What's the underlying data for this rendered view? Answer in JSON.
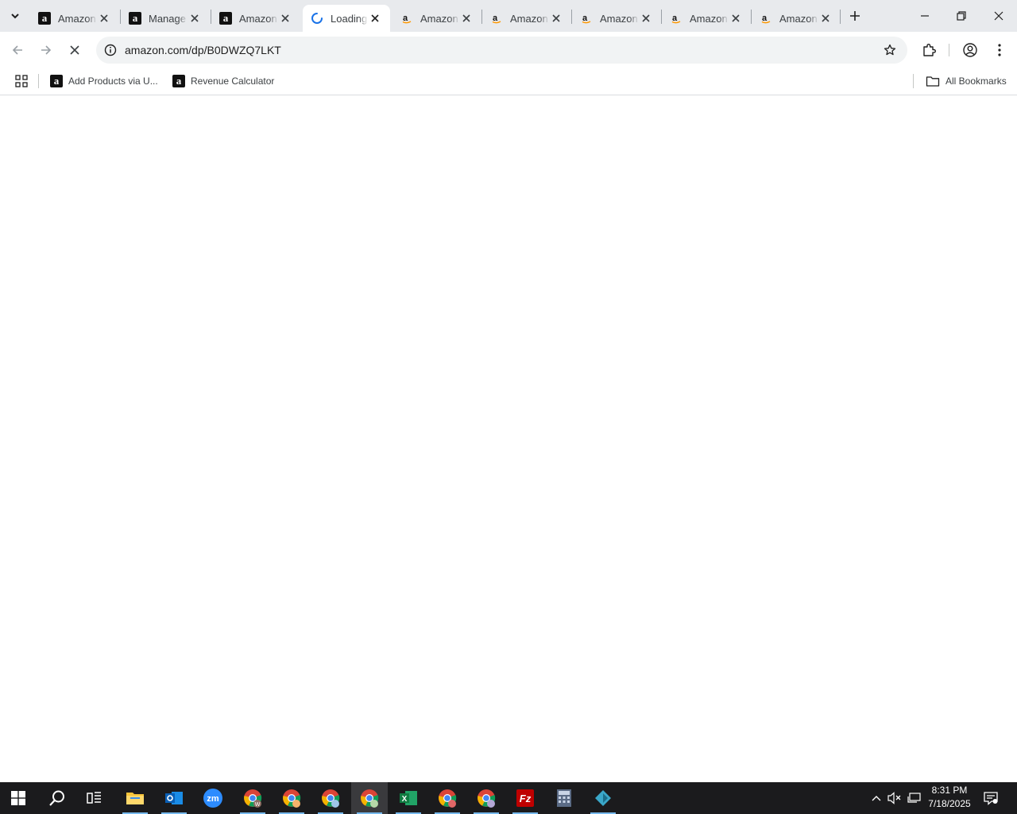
{
  "browser": {
    "tabs": [
      {
        "title": "Amazon",
        "favicon": "amazon-black-icon",
        "active": false
      },
      {
        "title": "Manage",
        "favicon": "amazon-black-icon",
        "active": false
      },
      {
        "title": "Amazon",
        "favicon": "amazon-black-icon",
        "active": false
      },
      {
        "title": "Loading",
        "favicon": "loading-spinner-icon",
        "active": true
      },
      {
        "title": "Amazon",
        "favicon": "amazon-smile-icon",
        "active": false
      },
      {
        "title": "Amazon",
        "favicon": "amazon-smile-icon",
        "active": false
      },
      {
        "title": "Amazon",
        "favicon": "amazon-smile-icon",
        "active": false
      },
      {
        "title": "Amazon",
        "favicon": "amazon-smile-icon",
        "active": false
      },
      {
        "title": "Amazon",
        "favicon": "amazon-smile-icon",
        "active": false
      }
    ],
    "address": {
      "url": "amazon.com/dp/B0DWZQ7LKT"
    },
    "bookmarks": [
      {
        "label": "Add Products via U...",
        "favicon": "amazon-black-icon"
      },
      {
        "label": "Revenue Calculator",
        "favicon": "amazon-black-icon"
      }
    ],
    "all_bookmarks_label": "All Bookmarks"
  },
  "taskbar": {
    "apps": [
      "start",
      "search",
      "task-view",
      "file-explorer",
      "outlook",
      "zoom",
      "chrome",
      "chrome",
      "chrome",
      "chrome",
      "excel",
      "chrome",
      "chrome",
      "filezilla",
      "calculator",
      "app"
    ],
    "time": "8:31 PM",
    "date": "7/18/2025"
  },
  "colors": {
    "tabstrip": "#e8eaed",
    "omnibox": "#f1f3f4",
    "taskbar": "#1b1b1d",
    "accent": "#1a73e8"
  }
}
